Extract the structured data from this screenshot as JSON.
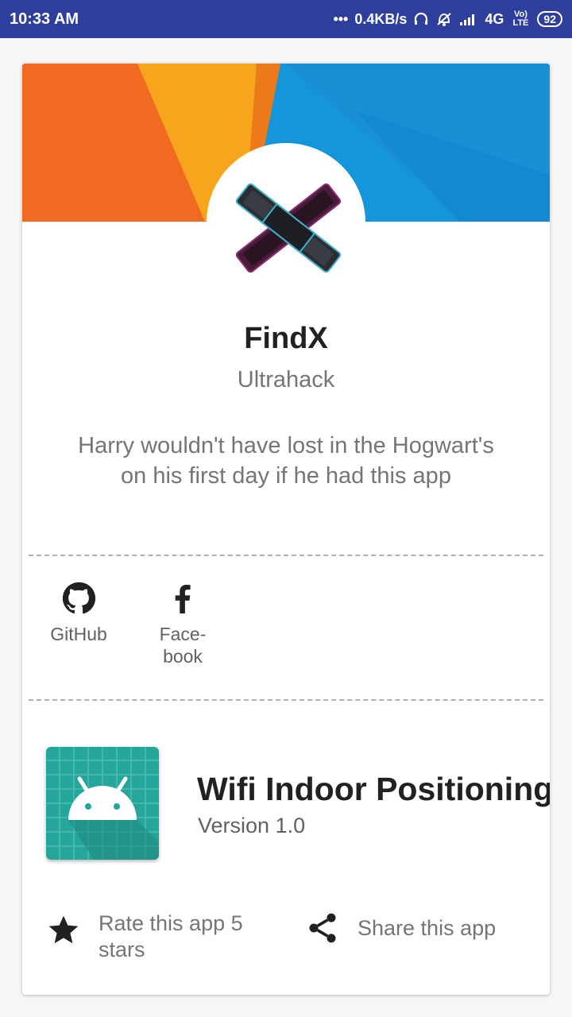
{
  "status_bar": {
    "time": "10:33 AM",
    "network_speed": "0.4KB/s",
    "network_type": "4G",
    "volte": "Vo) LTE",
    "battery": "92",
    "icons": [
      "dots-icon",
      "headphones-icon",
      "alarm-off-icon",
      "signal-icon",
      "volte-icon",
      "battery-icon"
    ]
  },
  "profile": {
    "name": "FindX",
    "team": "Ultrahack",
    "description": "Harry wouldn't have lost in the Hogwart's on his first day if he had this app"
  },
  "links": [
    {
      "label": "GitHub",
      "icon": "github-icon"
    },
    {
      "label": "Face-\nbook",
      "icon": "facebook-icon"
    }
  ],
  "app": {
    "name": "Wifi Indoor Positioning",
    "version": "Version 1.0",
    "icon": "android-icon"
  },
  "actions": {
    "rate": {
      "label": "Rate this app 5 stars",
      "icon": "star-icon"
    },
    "share": {
      "label": "Share this app",
      "icon": "share-icon"
    }
  },
  "colors": {
    "status_bar": "#2e3e9c",
    "banner_orange": "#f06a22",
    "banner_yellow": "#f7a51c",
    "banner_blue": "#1495dc",
    "app_icon_teal": "#26a69a"
  }
}
